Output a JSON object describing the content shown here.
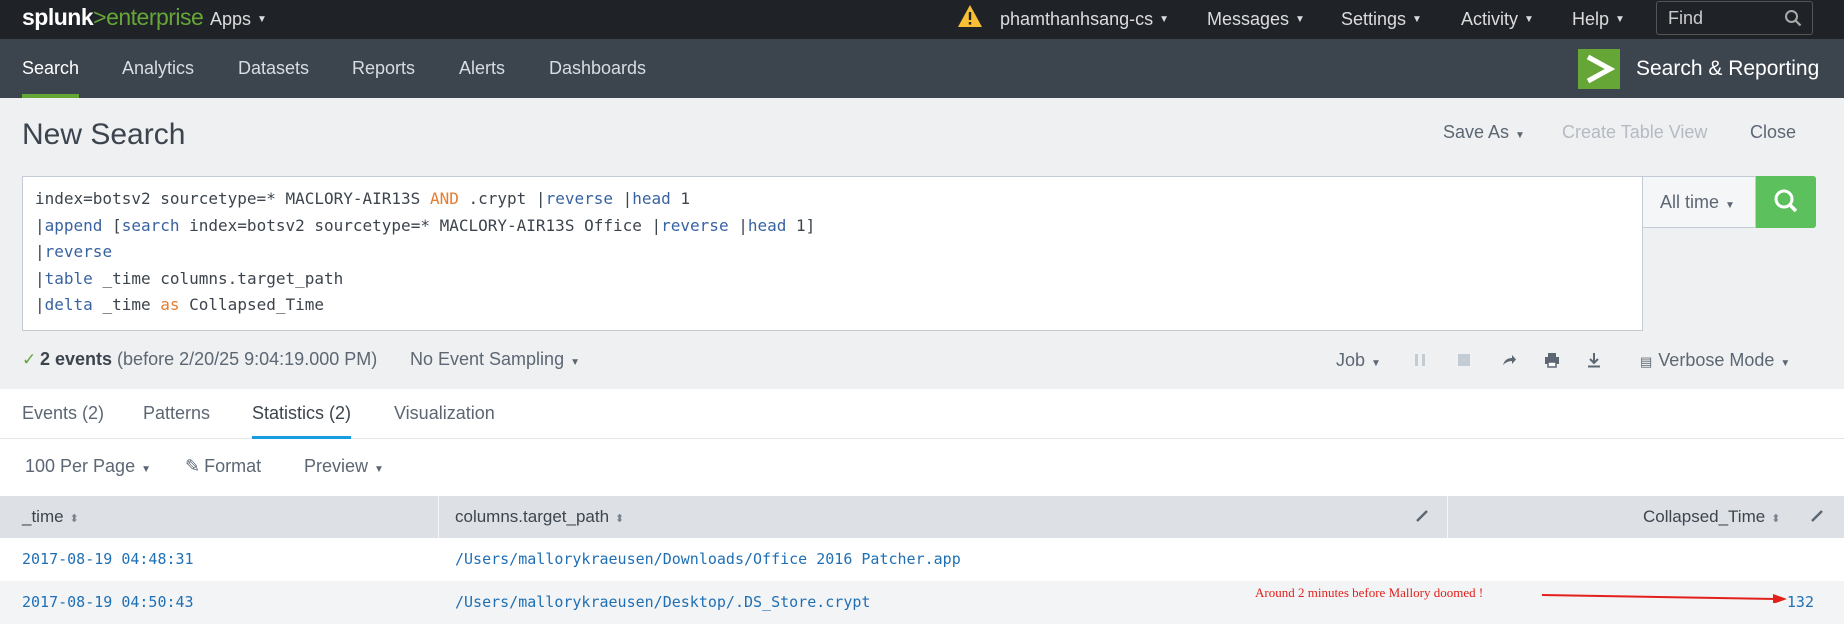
{
  "topbar": {
    "logo_main": "splunk",
    "logo_gt": ">",
    "logo_sub": "enterprise",
    "apps_label": "Apps",
    "user_label": "phamthanhsang-cs",
    "messages_label": "Messages",
    "settings_label": "Settings",
    "activity_label": "Activity",
    "help_label": "Help",
    "find_placeholder": "Find"
  },
  "appbar": {
    "tabs": [
      "Search",
      "Analytics",
      "Datasets",
      "Reports",
      "Alerts",
      "Dashboards"
    ],
    "active_tab": "Search",
    "app_name": "Search & Reporting"
  },
  "header": {
    "title": "New Search",
    "save_as": "Save As",
    "create_table_view": "Create Table View",
    "close": "Close"
  },
  "search": {
    "lines": [
      [
        "index=botsv2 sourcetype=* MACLORY-AIR13S ",
        "AND",
        " .crypt |",
        "reverse",
        " |",
        "head",
        " 1"
      ],
      [
        "|",
        "append",
        " [",
        "search",
        " index=botsv2 sourcetype=* MACLORY-AIR13S Office |",
        "reverse",
        " |",
        "head",
        " 1]"
      ],
      [
        "|",
        "reverse"
      ],
      [
        "|",
        "table",
        " _time columns.target_path"
      ],
      [
        "|",
        "delta",
        " _time ",
        "as",
        " Collapsed_Time"
      ]
    ],
    "time_range": "All time"
  },
  "status": {
    "events_count": "2 events",
    "events_detail": " (before 2/20/25 9:04:19.000 PM)",
    "sampling": "No Event Sampling",
    "job": "Job",
    "mode": "Verbose Mode"
  },
  "result_tabs": [
    "Events (2)",
    "Patterns",
    "Statistics (2)",
    "Visualization"
  ],
  "active_result_tab": "Statistics (2)",
  "options": {
    "per_page": "100 Per Page",
    "format": "Format",
    "preview": "Preview"
  },
  "table": {
    "columns": [
      "_time",
      "columns.target_path",
      "Collapsed_Time"
    ],
    "rows": [
      {
        "time": "2017-08-19 04:48:31",
        "path": "/Users/mallorykraeusen/Downloads/Office 2016 Patcher.app",
        "collapsed": ""
      },
      {
        "time": "2017-08-19 04:50:43",
        "path": "/Users/mallorykraeusen/Desktop/.DS_Store.crypt",
        "collapsed": "132"
      }
    ]
  },
  "annotation": {
    "text": "Around 2 minutes before Mallory doomed !",
    "color": "#e3211c"
  },
  "colors": {
    "accent_green": "#65a637",
    "search_button": "#5cc05c",
    "link_blue": "#1f6fb5",
    "tab_underline": "#1a9ce0"
  }
}
